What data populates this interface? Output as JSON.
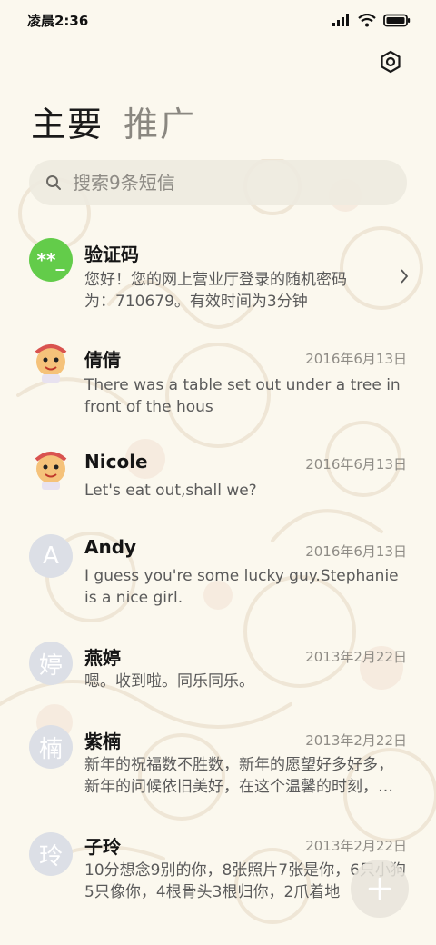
{
  "status_bar": {
    "time": "凌晨2:36",
    "icons": [
      "signal-icon",
      "wifi-icon",
      "battery-icon"
    ]
  },
  "header": {
    "settings_icon": "gear-icon",
    "tabs": [
      {
        "label": "主要",
        "active": true
      },
      {
        "label": "推广",
        "active": false
      }
    ]
  },
  "search": {
    "placeholder": "搜索9条短信",
    "icon": "search-icon"
  },
  "conversations": [
    {
      "name": "验证码",
      "avatar_text": "**_",
      "avatar_type": "green",
      "date": "",
      "preview": "您好！您的网上营业厅登录的随机密码为：710679。有效时间为3分钟"
    },
    {
      "name": "倩倩",
      "avatar_type": "emoji",
      "date": "2016年6月13日",
      "preview": "There was a table set out under a tree in front of the hous"
    },
    {
      "name": "Nicole",
      "avatar_type": "emoji",
      "date": "2016年6月13日",
      "preview": "Let's eat out,shall we?"
    },
    {
      "name": "Andy",
      "avatar_text": "A",
      "avatar_type": "letter",
      "date": "2016年6月13日",
      "preview": "I guess you're some lucky guy.Stephanie is a nice girl."
    },
    {
      "name": "燕婷",
      "avatar_text": "婷",
      "avatar_type": "letter",
      "date": "2013年2月22日",
      "preview": "嗯。收到啦。同乐同乐。"
    },
    {
      "name": "紫楠",
      "avatar_text": "楠",
      "avatar_type": "letter",
      "date": "2013年2月22日",
      "preview": "新年的祝福数不胜数，新年的愿望好多好多，新年的问候依旧美好，在这个温馨的时刻，…"
    },
    {
      "name": "子玲",
      "avatar_text": "玲",
      "avatar_type": "letter",
      "date": "2013年2月22日",
      "preview": "10分想念9别的你，8张照片7张是你，6只小狗5只像你，4根骨头3根归你，2爪着地"
    }
  ],
  "fab": {
    "icon": "plus-icon"
  },
  "colors": {
    "accent_green": "#63cc4a",
    "background": "#fbf8ee",
    "letter_avatar": "#dcdfe6"
  }
}
